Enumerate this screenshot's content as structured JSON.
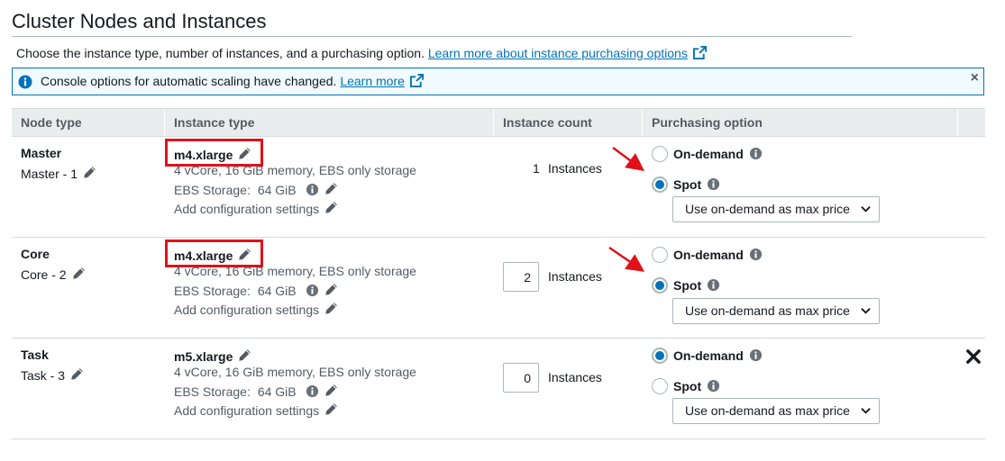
{
  "page": {
    "title": "Cluster Nodes and Instances",
    "subtitle": "Choose the instance type, number of instances, and a purchasing option.",
    "subtitle_link": "Learn more about instance purchasing options"
  },
  "alert": {
    "message": "Console options for automatic scaling have changed.",
    "link": "Learn more",
    "close": "×"
  },
  "table": {
    "headers": {
      "node_type": "Node type",
      "instance_type": "Instance type",
      "instance_count": "Instance count",
      "purchasing_option": "Purchasing option"
    },
    "rows": [
      {
        "node_type": "Master",
        "node_label": "Master - 1",
        "instance_type": "m4.xlarge",
        "instance_desc": "4 vCore, 16 GiB memory, EBS only storage",
        "ebs_label": "EBS Storage:",
        "ebs_value": "64 GiB",
        "add_config": "Add configuration settings",
        "count": "1",
        "count_label": "Instances",
        "on_demand": "On-demand",
        "spot": "Spot",
        "selected": "spot",
        "price_option": "Use on-demand as max price"
      },
      {
        "node_type": "Core",
        "node_label": "Core - 2",
        "instance_type": "m4.xlarge",
        "instance_desc": "4 vCore, 16 GiB memory, EBS only storage",
        "ebs_label": "EBS Storage:",
        "ebs_value": "64 GiB",
        "add_config": "Add configuration settings",
        "count": "2",
        "count_label": "Instances",
        "on_demand": "On-demand",
        "spot": "Spot",
        "selected": "spot",
        "price_option": "Use on-demand as max price"
      },
      {
        "node_type": "Task",
        "node_label": "Task - 3",
        "instance_type": "m5.xlarge",
        "instance_desc": "4 vCore, 16 GiB memory, EBS only storage",
        "ebs_label": "EBS Storage:",
        "ebs_value": "64 GiB",
        "add_config": "Add configuration settings",
        "count": "0",
        "count_label": "Instances",
        "on_demand": "On-demand",
        "spot": "Spot",
        "selected": "on-demand",
        "price_option": "Use on-demand as max price"
      }
    ]
  },
  "icons": {
    "info": "info-icon",
    "pencil": "pencil-icon",
    "external": "external-link-icon",
    "remove": "remove-icon",
    "chevron": "chevron-down-icon"
  },
  "colors": {
    "link": "#0073bb",
    "alert_border": "#0073bb",
    "alert_bg": "#f1faff",
    "highlight": "#e1111a",
    "header_bg": "#eaeded"
  }
}
